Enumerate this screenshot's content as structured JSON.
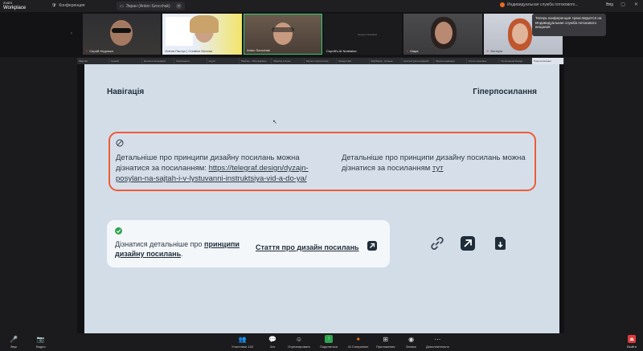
{
  "app": {
    "logo_line1": "zoom",
    "logo_line2": "Workplace"
  },
  "topbar": {
    "conference_label": "Конференция",
    "share_label": "Экран (Anton Szocchak)",
    "recording_label": "Индивидуальная служба потокового...",
    "view_label": "Вид",
    "win_min": "—",
    "win_max": "▢",
    "win_close": "✕"
  },
  "participants": [
    {
      "name": "Сергій Неділько",
      "muted": true
    },
    {
      "name": "Олена Пастух | Creative Director",
      "muted": false
    },
    {
      "name": "Anton Szocchak",
      "muted": false
    },
    {
      "name": "Сергій's AI Notetaker",
      "muted": false
    },
    {
      "name": "Мара",
      "muted": true
    },
    {
      "name": "Валерія",
      "muted": true
    }
  ],
  "tile4_text": "Sergiy's Notetaker",
  "notice": {
    "text": "Теперь конференция транслируется на Индивидуальная служба потокового вещания"
  },
  "browser_tabs": [
    "Мікроінт",
    "Кнопки",
    "Кнопки в Інтерфейс",
    "Компоненти",
    "Log In",
    "Мейлер - Збір фідбеку",
    "Meeting в Zoom",
    "Figma з прототипом",
    "Design Hub",
    "WebStock - спільна",
    "Архітектура Інтерфейс",
    "Верхня навігація",
    "Стиль посилань",
    "Поліпшення Design",
    "Гіперпосилання"
  ],
  "slide": {
    "heading_left": "Навігація",
    "heading_right": "Гіперпосилання",
    "bad_left_text": "Детальніше про принципи дизайну посилань можна дізнатися за посиланням: ",
    "bad_left_link": "https://telegraf.design/dyzajn-posylan-na-sajtah-i-v-lystuvanni-instruktsiya-vid-a-do-ya/",
    "bad_right_text": "Детальніше про принципи дизайну посилань можна дізнатися за посиланням ",
    "bad_right_link": "тут",
    "good_text_1": "Дізнатися детальніше про ",
    "good_text_bold": "принципи дизайну посилань",
    "good_text_end": ".",
    "good_link": "Стаття про дизайн посилань"
  },
  "toolbar": {
    "audio": "Звук",
    "video": "Видео",
    "participants": "Участники",
    "participants_count": "143",
    "chat": "Чат",
    "react": "Отреагировать",
    "share": "Поделиться",
    "ai": "AI Companion",
    "apps": "Приложения",
    "record": "Запись",
    "more": "Дополнительно",
    "leave": "Выйти"
  },
  "colors": {
    "accent_orange": "#ef5a36",
    "share_green": "#2ea44f",
    "leave_red": "#e23b3b"
  }
}
